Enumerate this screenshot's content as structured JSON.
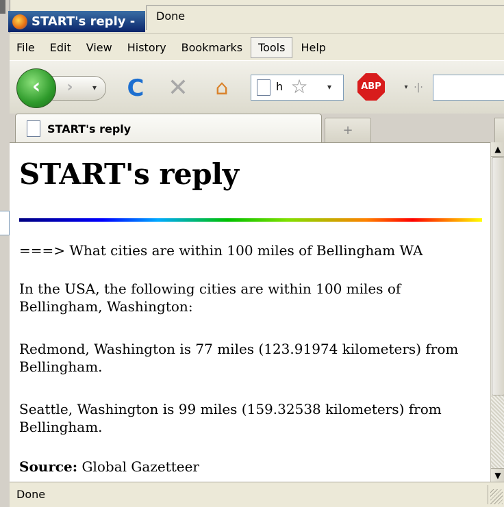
{
  "window": {
    "title": "START's reply -",
    "top_status": "Done"
  },
  "menu": [
    "File",
    "Edit",
    "View",
    "History",
    "Bookmarks",
    "Tools",
    "Help"
  ],
  "toolbar": {
    "back_glyph": "‹",
    "forward_glyph": "›",
    "dropdown_glyph": "▾",
    "reload_glyph": "C",
    "stop_glyph": "✕",
    "home_glyph": "⌂",
    "url_text": "h",
    "star_glyph": "☆",
    "abp_label": "ABP",
    "resizer_glyph": "·|·",
    "icons": [
      "back-icon",
      "forward-icon",
      "reload-icon",
      "stop-icon",
      "home-icon",
      "page-icon",
      "star-icon",
      "abp-icon"
    ]
  },
  "tabs": {
    "active_label": "START's reply",
    "new_tab_glyph": "+"
  },
  "page": {
    "heading": "START's reply",
    "query": "===> What cities are within 100 miles of Bellingham WA",
    "intro": "In the USA, the following cities are within 100 miles of Bellingham, Washington:",
    "result_redmond": "Redmond, Washington is 77 miles (123.91974 kilometers) from Bellingham.",
    "result_seattle": "Seattle, Washington is 99 miles (159.32538 kilometers) from Bellingham.",
    "source_label": "Source:",
    "source_value": "Global Gazetteer"
  },
  "scrollbar": {
    "up_glyph": "▲",
    "down_glyph": "▼"
  },
  "status": {
    "text": "Done"
  },
  "colors": {
    "title_bar": "#0a246a",
    "chrome": "#ece9d8",
    "back_button": "#2e9a2b",
    "reload": "#1d6fd0",
    "abp": "#d81c1c"
  }
}
